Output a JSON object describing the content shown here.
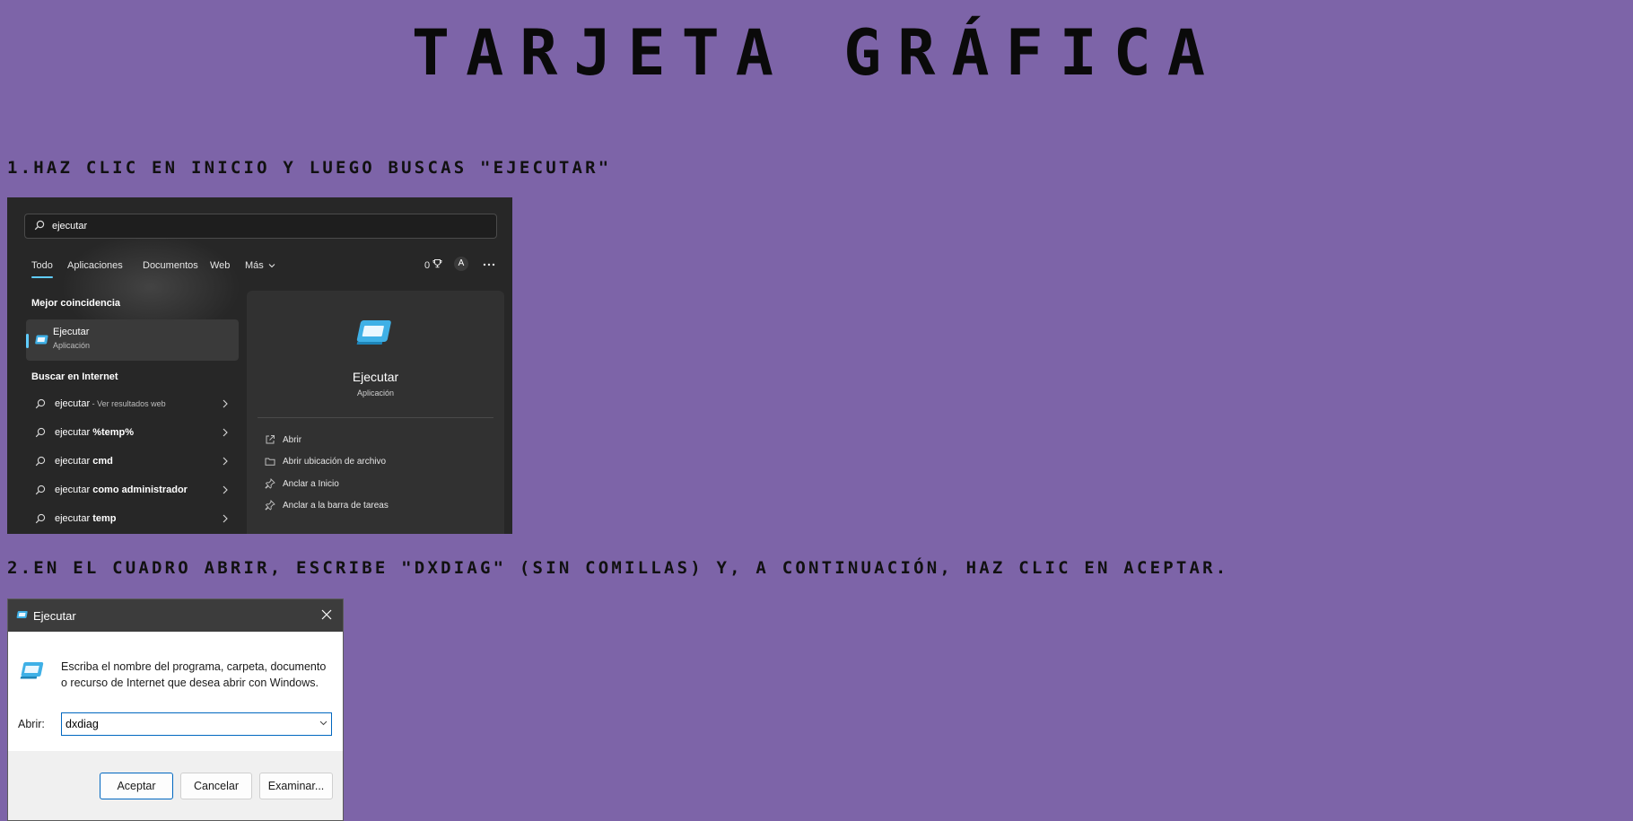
{
  "title": "TARJETA GRÁFICA",
  "steps": [
    "1.HAZ CLIC EN INICIO Y LUEGO BUSCAS \"EJECUTAR\"",
    "2.EN EL CUADRO ABRIR, ESCRIBE \"DXDIAG\" (SIN COMILLAS) Y, A CONTINUACIÓN, HAZ CLIC EN ACEPTAR."
  ],
  "search_window": {
    "query": "ejecutar",
    "filters": [
      "Todo",
      "Aplicaciones",
      "Documentos",
      "Web",
      "Más"
    ],
    "points": "0",
    "avatar_letter": "A",
    "best_match_heading": "Mejor coincidencia",
    "best_match": {
      "name": "Ejecutar",
      "kind": "Aplicación"
    },
    "web_heading": "Buscar en Internet",
    "web_results": [
      {
        "prefix": "ejecutar",
        "bold": "",
        "sub": " - Ver resultados web"
      },
      {
        "prefix": "ejecutar ",
        "bold": "%temp%",
        "sub": ""
      },
      {
        "prefix": "ejecutar ",
        "bold": "cmd",
        "sub": ""
      },
      {
        "prefix": "ejecutar ",
        "bold": "como administrador",
        "sub": ""
      },
      {
        "prefix": "ejecutar ",
        "bold": "temp",
        "sub": ""
      }
    ],
    "detail": {
      "name": "Ejecutar",
      "kind": "Aplicación",
      "actions": [
        "Abrir",
        "Abrir ubicación de archivo",
        "Anclar a Inicio",
        "Anclar a la barra de tareas"
      ]
    },
    "accent": "#60cdff"
  },
  "run_dialog": {
    "title": "Ejecutar",
    "description": "Escriba el nombre del programa, carpeta, documento o recurso de Internet que desea abrir con Windows.",
    "open_label": "Abrir:",
    "open_value": "dxdiag",
    "buttons": {
      "ok": "Aceptar",
      "cancel": "Cancelar",
      "browse": "Examinar..."
    }
  },
  "colors": {
    "background": "#7d64a8",
    "accent_blue": "#0067c0"
  }
}
